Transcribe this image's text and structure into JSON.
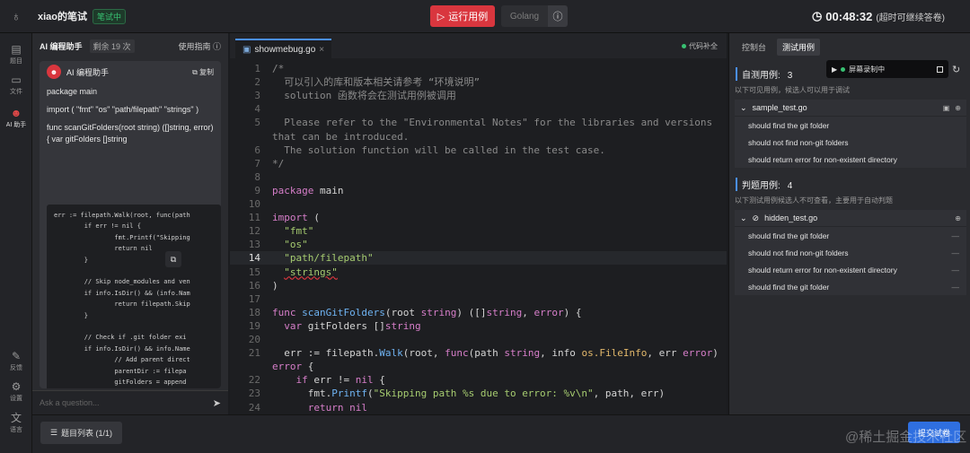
{
  "header": {
    "app_title": "xiao的笔试",
    "status_badge": "笔试中",
    "run_label": "运行用例",
    "language": "Golang",
    "timer": "00:48:32",
    "timer_note": "(超时可继续答卷)"
  },
  "rail": {
    "items": [
      {
        "label": "题目",
        "icon": "list-icon"
      },
      {
        "label": "文件",
        "icon": "file-icon"
      },
      {
        "label": "AI 助手",
        "icon": "robot-icon"
      },
      {
        "label": "反馈",
        "icon": "feedback-icon"
      },
      {
        "label": "设置",
        "icon": "gear-icon"
      },
      {
        "label": "语言",
        "icon": "language-icon"
      }
    ]
  },
  "ai": {
    "title": "AI 编程助手",
    "remaining": "剩余 19 次",
    "guide": "使用指南",
    "chat_name": "AI 编程助手",
    "copy_label": "复制",
    "messages": [
      "package main",
      "import ( \"fmt\" \"os\" \"path/filepath\" \"strings\" )",
      "func scanGitFolders(root string) ([]string, error) { var gitFolders []string"
    ],
    "code": "err := filepath.Walk(root, func(path\n        if err != nil {\n                fmt.Printf(\"Skipping\n                return nil\n        }\n\n        // Skip node_modules and ven\n        if info.IsDir() && (info.Nam\n                return filepath.Skip\n        }\n\n        // Check if .git folder exi\n        if info.IsDir() && info.Name\n                // Add parent direct\n                parentDir := filepa\n                gitFolders = append\n\n                // Skip remaining s",
    "input_placeholder": "Ask a question..."
  },
  "editor": {
    "tab_name": "showmebug.go",
    "autocomplete": "代码补全",
    "active_line": 14,
    "lines": [
      {
        "n": "1",
        "html": "<span class='c-comment'>/*</span>"
      },
      {
        "n": "2",
        "html": "<span class='c-comment'>  可以引入的库和版本相关请参考 “环境说明”</span>"
      },
      {
        "n": "3",
        "html": "<span class='c-comment'>  solution 函数将会在测试用例被调用</span>"
      },
      {
        "n": "4",
        "html": ""
      },
      {
        "n": "5",
        "html": "<span class='c-comment'>  Please refer to the \"Environmental Notes\" for the libraries and versions</span>"
      },
      {
        "n": "",
        "html": "<span class='c-comment'>that can be introduced.</span>"
      },
      {
        "n": "6",
        "html": "<span class='c-comment'>  The solution function will be called in the test case.</span>"
      },
      {
        "n": "7",
        "html": "<span class='c-comment'>*/</span>"
      },
      {
        "n": "8",
        "html": ""
      },
      {
        "n": "9",
        "html": "<span class='c-kw'>package</span> <span class='c-id'>main</span>"
      },
      {
        "n": "10",
        "html": ""
      },
      {
        "n": "11",
        "html": "<span class='c-kw'>import</span> ("
      },
      {
        "n": "12",
        "html": "  <span class='c-str'>\"fmt\"</span>"
      },
      {
        "n": "13",
        "html": "  <span class='c-str'>\"os\"</span>"
      },
      {
        "n": "14",
        "html": "  <span class='c-str'>\"path/filepath\"</span>"
      },
      {
        "n": "15",
        "html": "  <span class='c-str sq'>\"strings\"</span>"
      },
      {
        "n": "16",
        "html": ")"
      },
      {
        "n": "17",
        "html": ""
      },
      {
        "n": "18",
        "html": "<span class='c-kw'>func</span> <span class='c-fn'>scanGitFolders</span>(<span class='c-id'>root</span> <span class='c-kw'>string</span>) ([]<span class='c-kw'>string</span>, <span class='c-kw'>error</span>) {"
      },
      {
        "n": "19",
        "html": "  <span class='c-kw'>var</span> <span class='c-id'>gitFolders</span> []<span class='c-kw'>string</span>"
      },
      {
        "n": "20",
        "html": ""
      },
      {
        "n": "21",
        "html": "  <span class='c-id'>err</span> := <span class='c-id'>filepath</span>.<span class='c-fn'>Walk</span>(<span class='c-id'>root</span>, <span class='c-kw'>func</span>(<span class='c-id'>path</span> <span class='c-kw'>string</span>, <span class='c-id'>info</span> <span class='c-typ'>os.FileInfo</span>, <span class='c-id'>err</span> <span class='c-kw'>error</span>)"
      },
      {
        "n": "",
        "html": "<span class='c-kw'>error</span> {"
      },
      {
        "n": "22",
        "html": "    <span class='c-kw'>if</span> <span class='c-id'>err</span> != <span class='c-kw'>nil</span> {"
      },
      {
        "n": "23",
        "html": "      <span class='c-id'>fmt</span>.<span class='c-fn'>Printf</span>(<span class='c-str'>\"Skipping path %s due to error: %v\\n\"</span>, <span class='c-id'>path</span>, <span class='c-id'>err</span>)"
      },
      {
        "n": "24",
        "html": "      <span class='c-kw'>return</span> <span class='c-kw'>nil</span>"
      }
    ]
  },
  "right": {
    "tabs": [
      "控制台",
      "测试用例"
    ],
    "recording": "屏幕录制中",
    "self_title": "自测用例:",
    "self_count": "3",
    "self_desc": "以下可见用例，候选人可以用于调试",
    "sample_file": "sample_test.go",
    "sample_cases": [
      "should find the git folder",
      "should not find non-git folders",
      "should return error for non-existent directory"
    ],
    "judge_title": "判题用例:",
    "judge_count": "4",
    "judge_desc": "以下测试用例候选人不可查看，主要用于自动判题",
    "hidden_file": "hidden_test.go",
    "hidden_cases": [
      "should find the git folder",
      "should not find non-git folders",
      "should return error for non-existent directory",
      "should find the git folder"
    ]
  },
  "footer": {
    "problem_list": "题目列表 (1/1)",
    "submit": "提交试卷",
    "watermark": "@稀土掘金技术社区"
  }
}
